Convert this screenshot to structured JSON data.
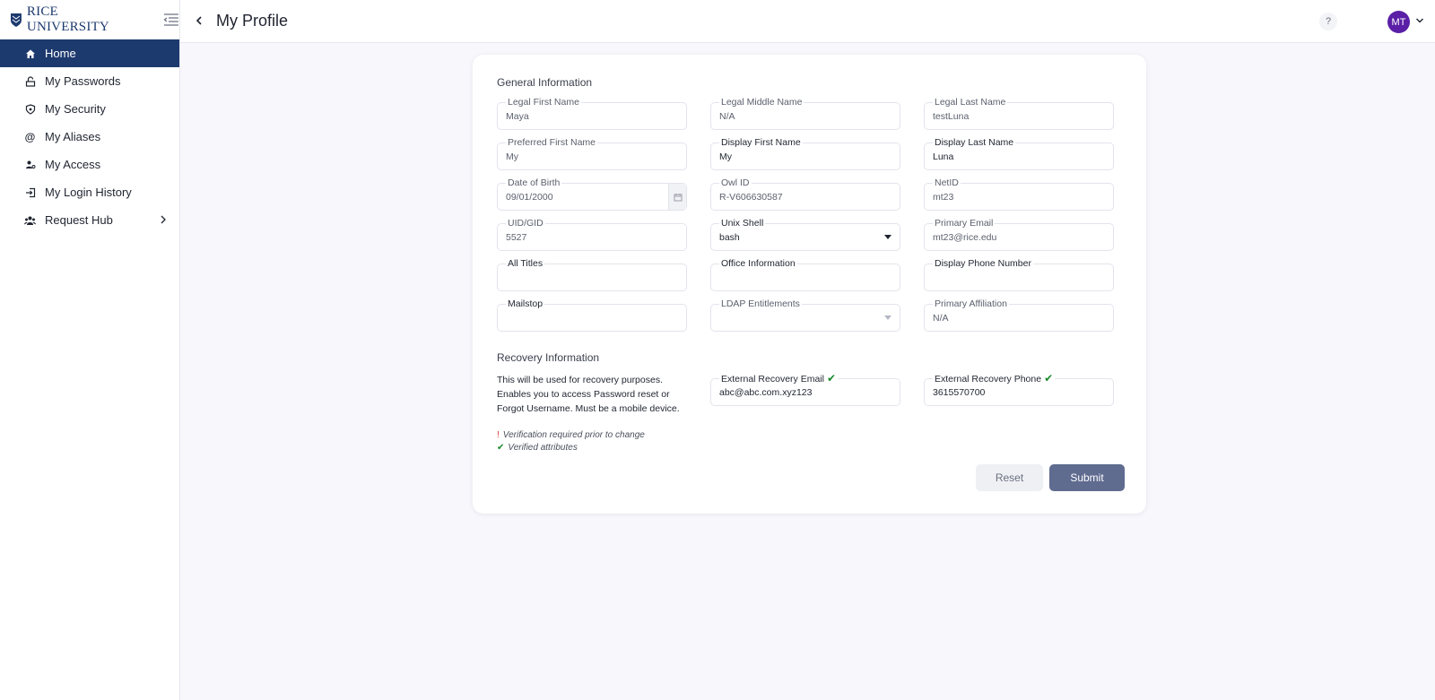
{
  "brand": {
    "logo_text": "RICE UNIVERSITY"
  },
  "header": {
    "title": "My Profile",
    "help_label": "?",
    "avatar_initials": "MT"
  },
  "sidebar": {
    "items": [
      {
        "label": "Home",
        "icon": "home-icon"
      },
      {
        "label": "My Passwords",
        "icon": "password-icon"
      },
      {
        "label": "My Security",
        "icon": "shield-icon"
      },
      {
        "label": "My Aliases",
        "icon": "at-icon"
      },
      {
        "label": "My Access",
        "icon": "access-icon"
      },
      {
        "label": "My Login History",
        "icon": "login-icon"
      },
      {
        "label": "Request Hub",
        "icon": "users-icon"
      }
    ]
  },
  "general": {
    "title": "General Information",
    "fields": {
      "legal_first": {
        "label": "Legal First Name",
        "value": "Maya"
      },
      "legal_middle": {
        "label": "Legal Middle Name",
        "value": "N/A"
      },
      "legal_last": {
        "label": "Legal Last Name",
        "value": "testLuna"
      },
      "preferred_first": {
        "label": "Preferred First Name",
        "value": "My"
      },
      "display_first": {
        "label": "Display First Name",
        "value": "My"
      },
      "display_last": {
        "label": "Display Last Name",
        "value": "Luna"
      },
      "dob": {
        "label": "Date of Birth",
        "value": "09/01/2000"
      },
      "owl_id": {
        "label": "Owl ID",
        "value": "R-V606630587"
      },
      "netid": {
        "label": "NetID",
        "value": "mt23"
      },
      "uid_gid": {
        "label": "UID/GID",
        "value": "5527"
      },
      "unix_shell": {
        "label": "Unix Shell",
        "value": "bash"
      },
      "primary_email": {
        "label": "Primary Email",
        "value": "mt23@rice.edu"
      },
      "all_titles": {
        "label": "All Titles",
        "value": ""
      },
      "office_info": {
        "label": "Office Information",
        "value": ""
      },
      "display_phone": {
        "label": "Display Phone Number",
        "value": ""
      },
      "mailstop": {
        "label": "Mailstop",
        "value": ""
      },
      "ldap": {
        "label": "LDAP Entitlements",
        "value": ""
      },
      "primary_affiliation": {
        "label": "Primary Affiliation",
        "value": "N/A"
      }
    }
  },
  "recovery": {
    "title": "Recovery Information",
    "description": "This will be used for recovery purposes. Enables you to access Password reset or Forgot Username. Must be a mobile device.",
    "email": {
      "label": "External Recovery Email",
      "value": "abc@abc.com.xyz123"
    },
    "phone": {
      "label": "External Recovery Phone",
      "value": "3615570700"
    },
    "legend_required": "Verification required prior to change",
    "legend_verified": "Verified attributes",
    "check_mark": "✔",
    "exclaim_mark": "!"
  },
  "actions": {
    "reset_label": "Reset",
    "submit_label": "Submit"
  },
  "colors": {
    "brand_navy": "#1d3a6e",
    "avatar_purple": "#5a1fa6",
    "submit": "#5f6b8f",
    "verified_green": "#1a8a2c"
  }
}
